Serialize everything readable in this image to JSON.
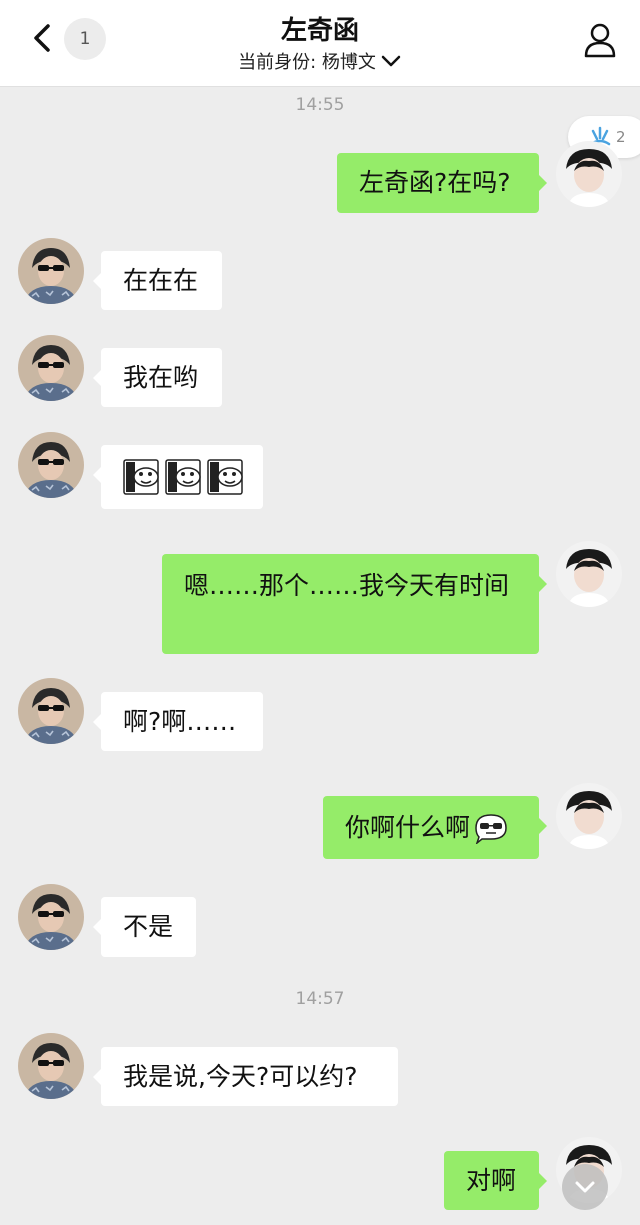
{
  "header": {
    "back_icon": "chevron-left-icon",
    "unread_count": "1",
    "title": "左奇函",
    "identity_label": "当前身份: 杨博文",
    "identity_icon": "chevron-down-icon",
    "profile_icon": "person-icon"
  },
  "reaction": {
    "icon": "splash-icon",
    "count": "2"
  },
  "messages": [
    {
      "type": "time",
      "text": "14:55"
    },
    {
      "type": "out",
      "text": "左奇函?在吗?"
    },
    {
      "type": "in",
      "text": "在在在"
    },
    {
      "type": "in",
      "text": "我在哟"
    },
    {
      "type": "in",
      "text": "",
      "sticker": "fish-sticker-icon"
    },
    {
      "type": "out",
      "text": "嗯……那个……我今天有时间"
    },
    {
      "type": "in",
      "text": "啊?啊……"
    },
    {
      "type": "out",
      "text": "你啊什么啊",
      "emoji": "sunglasses-face-icon"
    },
    {
      "type": "in",
      "text": "不是"
    },
    {
      "type": "time",
      "text": "14:57"
    },
    {
      "type": "in",
      "text": "我是说,今天?可以约?"
    },
    {
      "type": "out",
      "text": "对啊"
    }
  ],
  "scroll_icon": "chevron-down-icon",
  "colors": {
    "background": "#ededed",
    "bubble_out": "#95ec69",
    "bubble_in": "#ffffff",
    "timestamp": "#a0a0a0"
  }
}
